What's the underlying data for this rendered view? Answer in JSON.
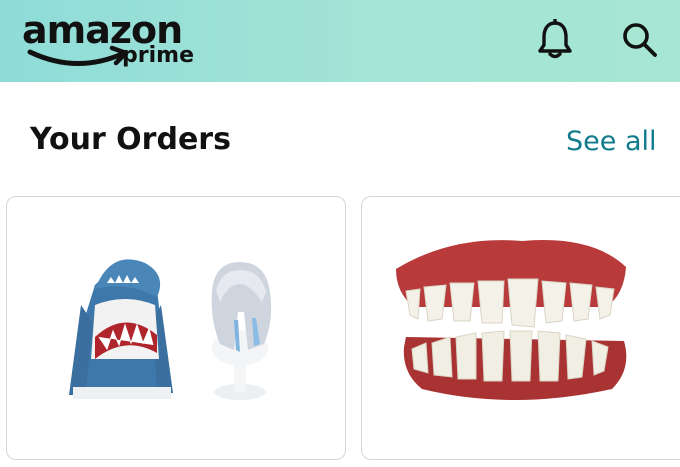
{
  "header": {
    "logo_word": "amazon",
    "logo_sub": "prime",
    "icons": [
      "bell-icon",
      "search-icon"
    ],
    "gradient": [
      "#8fdcd8",
      "#a6e6d2"
    ]
  },
  "orders": {
    "title": "Your Orders",
    "see_all": "See all",
    "link_color": "#0f7b8d",
    "items": [
      {
        "name": "shark-hoodie-and-wig-order",
        "images": [
          "shark-hoodie-image",
          "silver-wig-image"
        ]
      },
      {
        "name": "fake-teeth-order",
        "images": [
          "fake-teeth-image"
        ]
      }
    ]
  }
}
